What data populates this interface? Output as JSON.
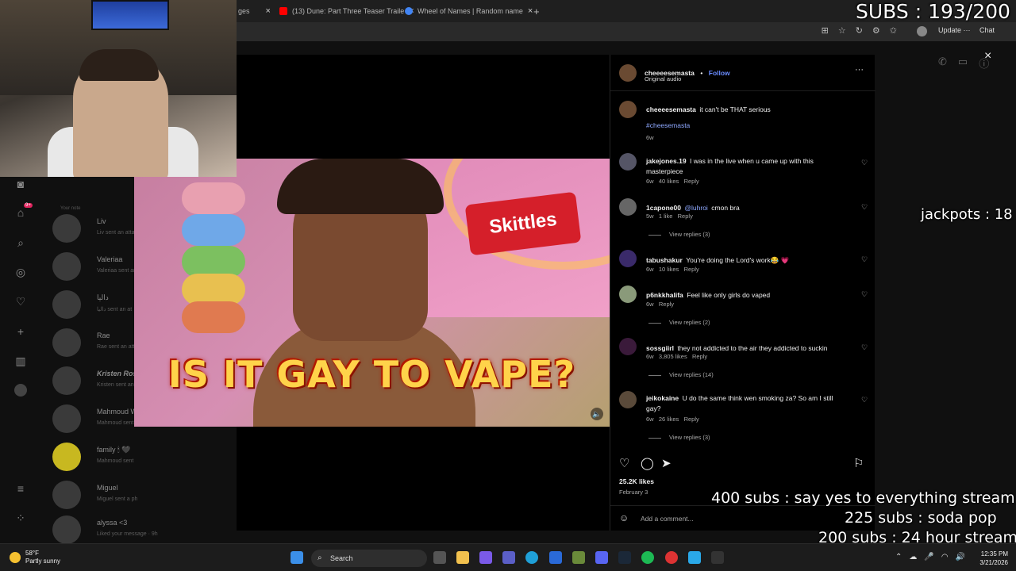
{
  "browser": {
    "tabs": [
      {
        "label": "ges",
        "favicon_color": "#c13584"
      },
      {
        "label": "(13) Dune: Part Three Teaser Traile",
        "favicon_color": "#ff0000"
      },
      {
        "label": "Wheel of Names | Random name",
        "favicon_color": "#4285f4"
      }
    ],
    "new_tab": "+",
    "close_glyph": "×",
    "update_label": "Update",
    "update_more": "···",
    "chat_label": "Chat"
  },
  "overlays": {
    "subs_counter": "SUBS : 193/200",
    "jackpots": "jackpots : 18",
    "goal_400": "400 subs :  say yes to everything stream",
    "goal_225": "225 subs : soda pop",
    "goal_200": "200 subs : 24 hour stream"
  },
  "sidebar": {
    "your_note": "Your note",
    "notif_badge": "9+",
    "dms": [
      {
        "name": "Liv",
        "sub": "Liv sent an attac"
      },
      {
        "name": "Valeriaa",
        "sub": "Valeriaa sent an"
      },
      {
        "name": "دالیا",
        "sub": "دالیا sent an at"
      },
      {
        "name": "Rae",
        "sub": "Rae sent an atta"
      },
      {
        "name": "Kristen Ros",
        "sub": "Kristen sent an"
      },
      {
        "name": "Mahmoud Wa",
        "sub": "Mahmoud sent"
      },
      {
        "name": "family 🕯 🖤",
        "sub": "Mahmoud sent"
      },
      {
        "name": "Miguel",
        "sub": "Miguel sent a ph"
      },
      {
        "name": "alyssa <3",
        "sub": "Liked your message · 9h"
      }
    ]
  },
  "video": {
    "headline": "IS IT GAY TO VAPE?",
    "sticker_brand": "Skittles",
    "mute_glyph": "🔈"
  },
  "post": {
    "author": "cheeeesemasta",
    "follow_sep": "•",
    "follow_label": "Follow",
    "audio": "Original audio",
    "more_glyph": "···",
    "caption_user": "cheeeesemasta",
    "caption_text": "it can't be THAT serious",
    "caption_tag": "#cheesemasta",
    "caption_age": "6w"
  },
  "comments": [
    {
      "user": "jakejones.19",
      "mention": "",
      "text": "I was in the live when u came up with this masterpiece",
      "age": "6w",
      "likes": "40 likes",
      "reply": "Reply",
      "view_replies": ""
    },
    {
      "user": "1capone00",
      "mention": "@luhroi",
      "text": "cmon bra",
      "age": "5w",
      "likes": "1 like",
      "reply": "Reply",
      "view_replies": "View replies (3)"
    },
    {
      "user": "tabushakur",
      "mention": "",
      "text": "You're doing the Lord's work😂 💗",
      "age": "6w",
      "likes": "10 likes",
      "reply": "Reply",
      "view_replies": ""
    },
    {
      "user": "p6nkkhalifa",
      "mention": "",
      "text": "Feel like only girls do vaped",
      "age": "6w",
      "likes": "",
      "reply": "Reply",
      "view_replies": "View replies (2)"
    },
    {
      "user": "sossgiirl",
      "mention": "",
      "text": "they not addicted to the air they addicted to suckin",
      "age": "6w",
      "likes": "3,805 likes",
      "reply": "Reply",
      "view_replies": "View replies (14)"
    },
    {
      "user": "jeikokaine",
      "mention": "",
      "text": "U do the same think wen smoking za? So am I still gay?",
      "age": "6w",
      "likes": "26 likes",
      "reply": "Reply",
      "view_replies": "View replies (3)"
    }
  ],
  "post_footer": {
    "likes": "25.2K likes",
    "date": "February 3",
    "add_comment_placeholder": "Add a comment..."
  },
  "taskbar": {
    "temp": "58°F",
    "condition": "Partly sunny",
    "search_label": "Search",
    "time": "12:35 PM",
    "date": "3/21/2026"
  },
  "colors": {
    "ig_link": "#8ea8ff",
    "overlay_text": "#ffffff",
    "headline": "#ffd34a"
  }
}
